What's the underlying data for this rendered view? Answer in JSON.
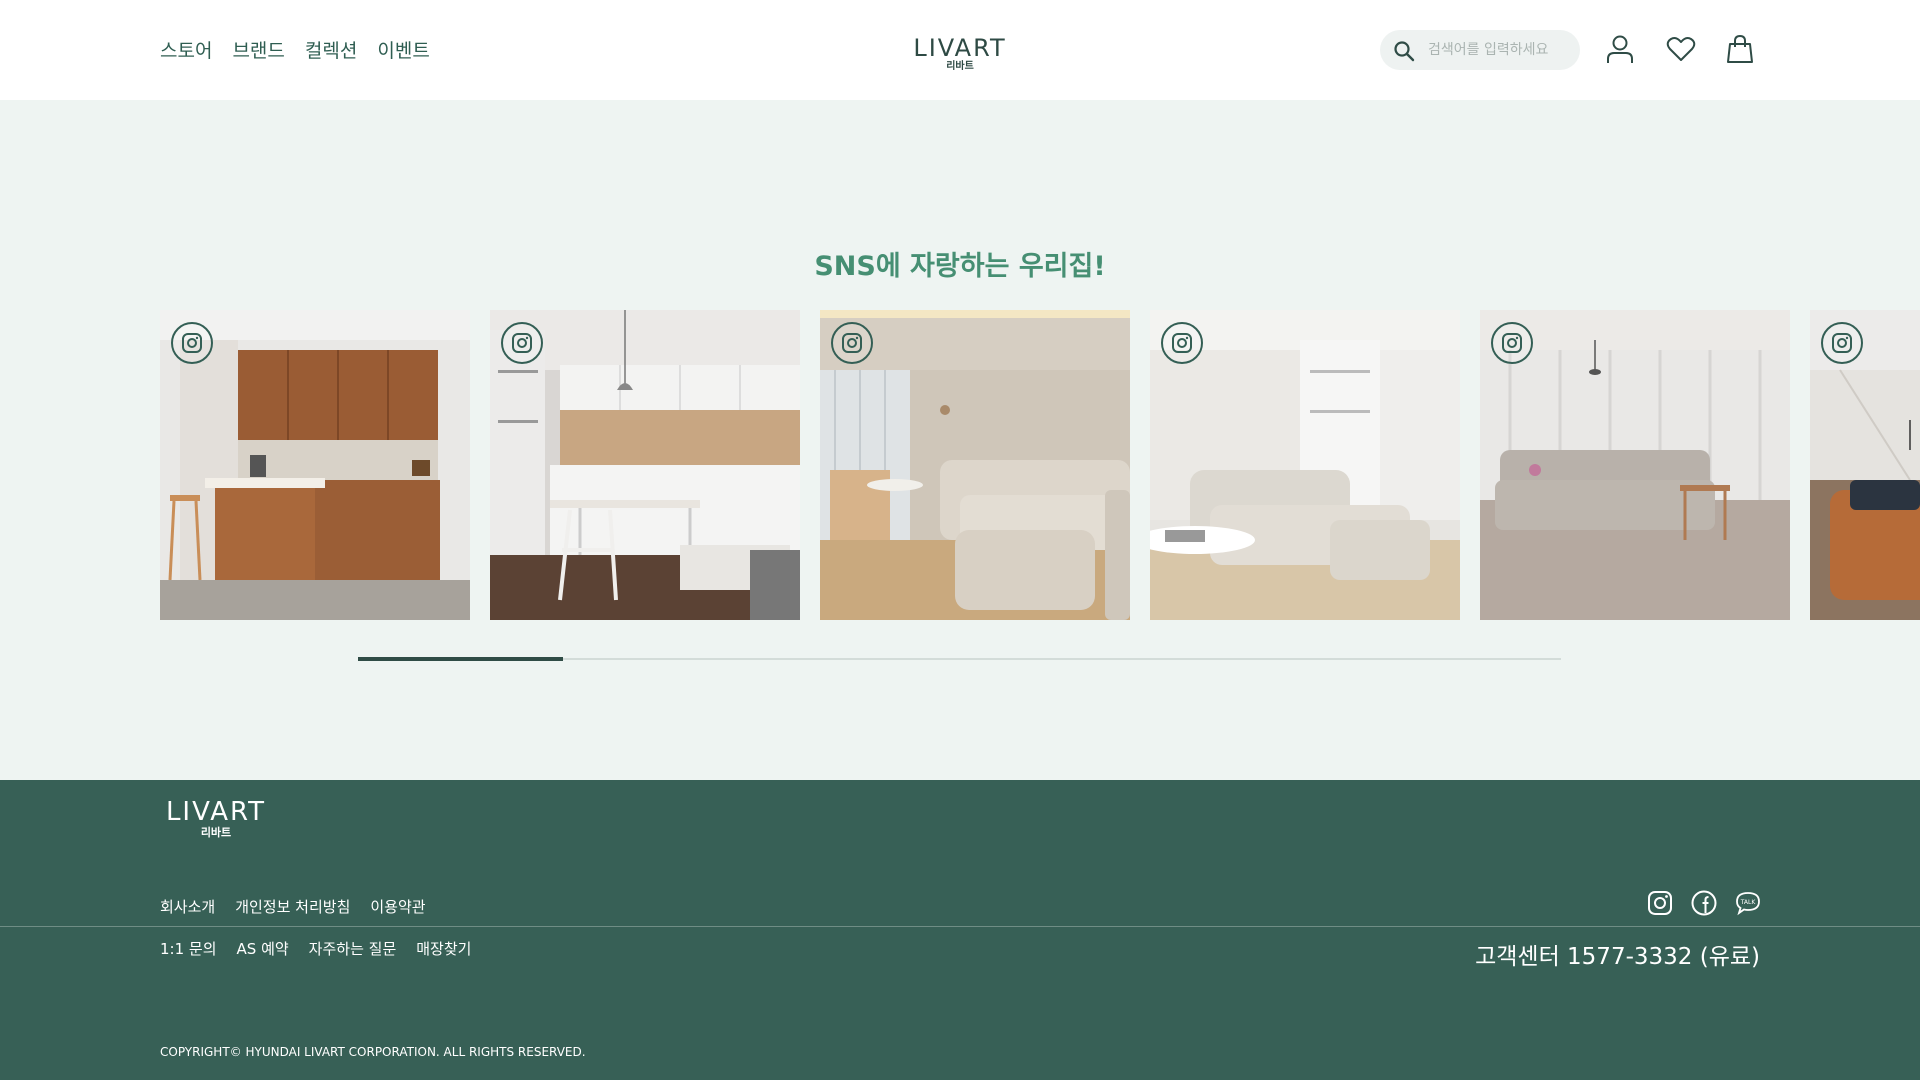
{
  "header": {
    "nav": [
      "스토어",
      "브랜드",
      "컬렉션",
      "이벤트"
    ],
    "logo": {
      "en": "LIVART",
      "ko": "리바트"
    },
    "search": {
      "placeholder": "검색어를 입력하세요"
    },
    "icons": [
      "user-icon",
      "heart-icon",
      "shopping-bag-icon"
    ]
  },
  "sns": {
    "title": "SNS에 자랑하는 우리집!",
    "tiles": [
      {
        "icon": "instagram-icon",
        "scene": "wood kitchen island"
      },
      {
        "icon": "instagram-icon",
        "scene": "white kitchen with dining table"
      },
      {
        "icon": "instagram-icon",
        "scene": "living room with beige sofa"
      },
      {
        "icon": "instagram-icon",
        "scene": "white corner sofa"
      },
      {
        "icon": "instagram-icon",
        "scene": "grey sofa with curtains"
      },
      {
        "icon": "instagram-icon",
        "scene": "leather sofa"
      }
    ],
    "scroll_progress": 0.17
  },
  "footer": {
    "logo": {
      "en": "LIVART",
      "ko": "리바트"
    },
    "links_row1": [
      "회사소개",
      "개인정보 처리방침",
      "이용약관"
    ],
    "links_row2": [
      "1:1 문의",
      "AS 예약",
      "자주하는 질문",
      "매장찾기"
    ],
    "social": [
      "instagram-icon",
      "facebook-icon",
      "kakaotalk-icon"
    ],
    "customer_center": "고객센터 1577-3332 (유료)",
    "copyright": "COPYRIGHT© HYUNDAI LIVART CORPORATION. ALL RIGHTS RESERVED."
  },
  "colors": {
    "brand_green": "#376056",
    "title_green": "#468f73",
    "section_bg": "#eef4f2"
  }
}
